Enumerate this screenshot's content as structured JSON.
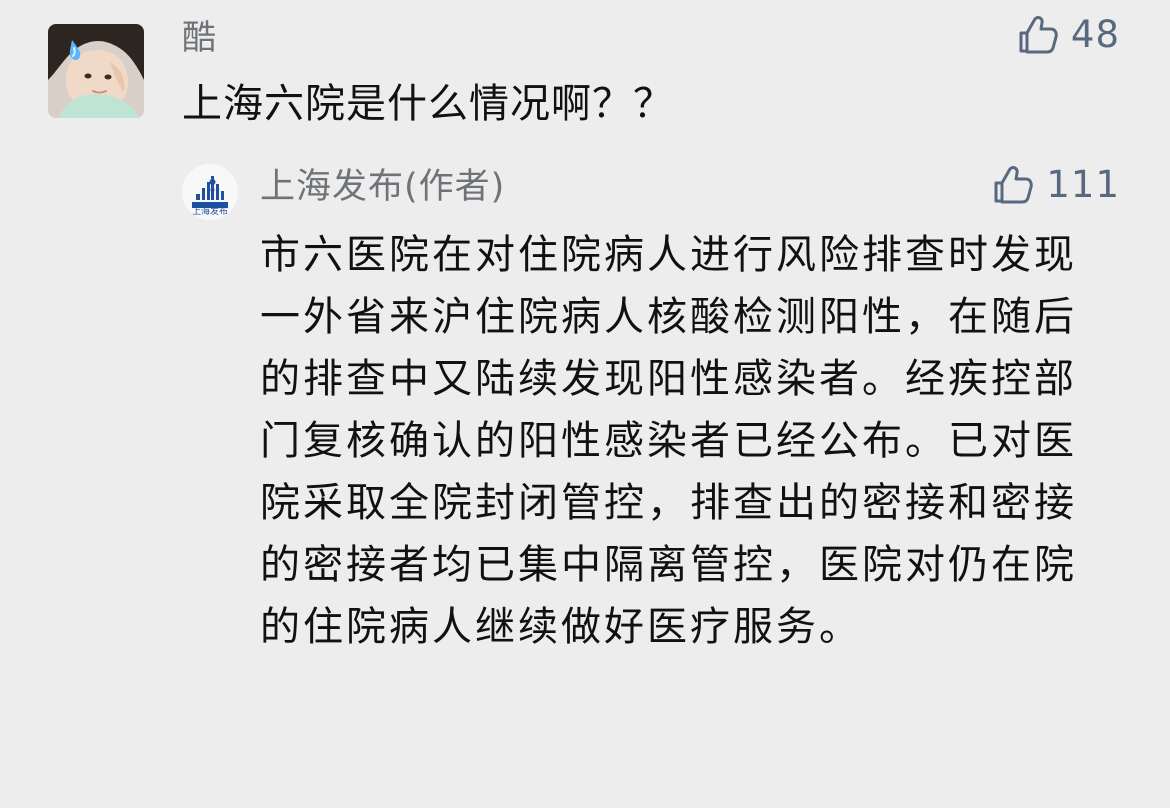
{
  "comment": {
    "username": "酷",
    "text": "上海六院是什么情况啊？？",
    "likes": "48"
  },
  "reply": {
    "author": "上海发布(作者)",
    "likes": "111",
    "avatar_label": "上海发布",
    "text": "市六医院在对住院病人进行风险排查时发现一外省来沪住院病人核酸检测阳性，在随后的排查中又陆续发现阳性感染者。经疾控部门复核确认的阳性感染者已经公布。已对医院采取全院封闭管控，排查出的密接和密接的密接者均已集中隔离管控，医院对仍在院的住院病人继续做好医疗服务。"
  },
  "icons": {
    "like": "thumbs-up-outline-icon",
    "avatar_user": "child-avatar",
    "avatar_official": "shanghai-skyline-logo"
  },
  "colors": {
    "background": "#ededed",
    "primary_text": "#111111",
    "secondary_text": "#6f7378",
    "like_icon": "#58697f",
    "official_badge": "#1f4f9f"
  }
}
